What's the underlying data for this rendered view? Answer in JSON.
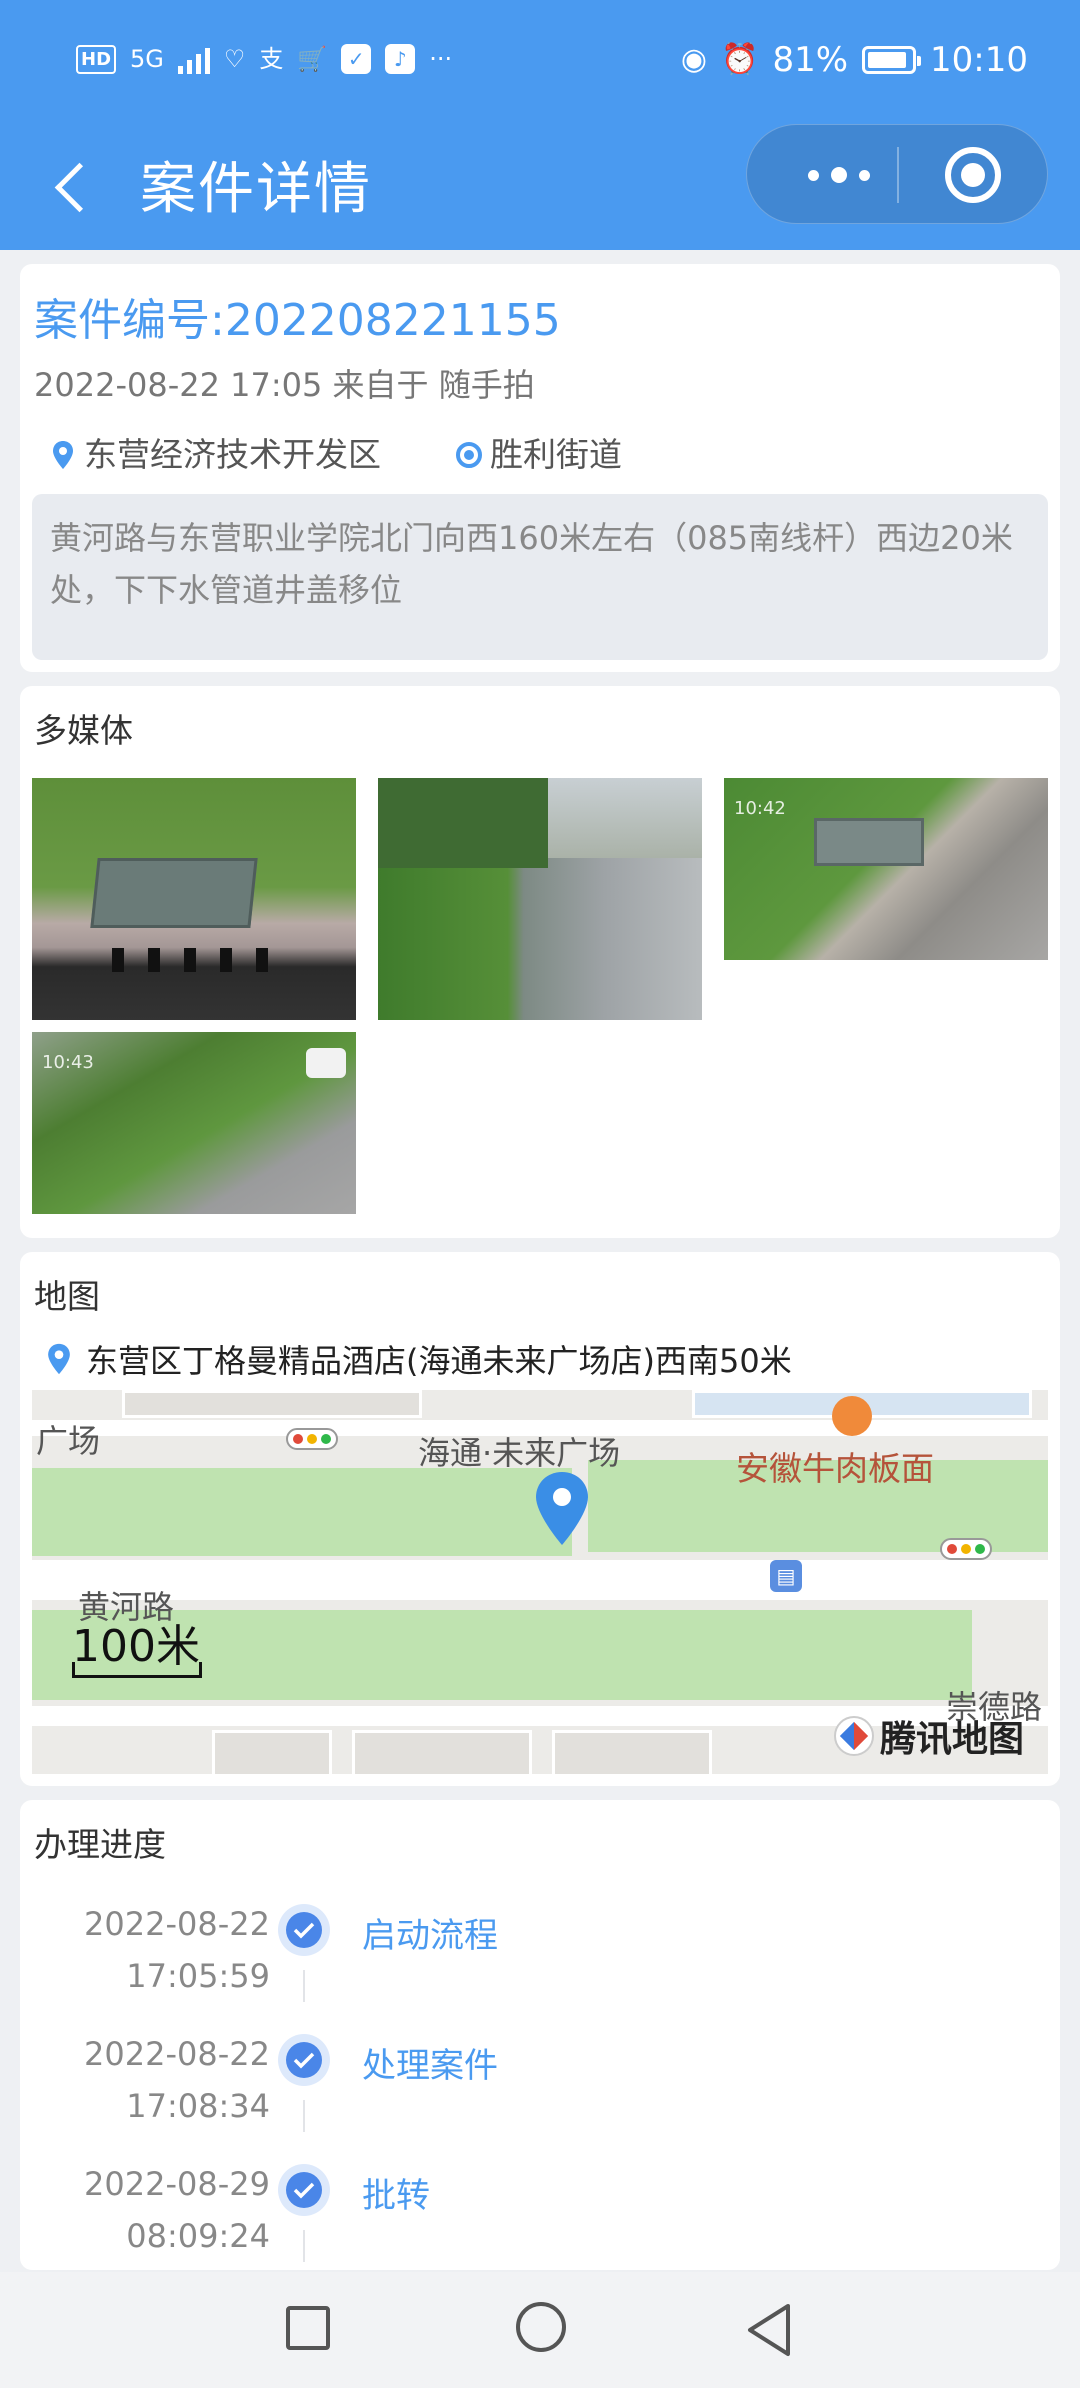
{
  "status_bar": {
    "network": "5G",
    "battery": "81%",
    "time": "10:10"
  },
  "header": {
    "title": "案件详情"
  },
  "case": {
    "number_label": "案件编号:202208221155",
    "meta": "2022-08-22 17:05 来自于 随手拍",
    "district": "东营经济技术开发区",
    "street": "胜利街道",
    "description": "黄河路与东营职业学院北门向西160米左右（085南线杆）西边20米处，下下水管道井盖移位"
  },
  "media": {
    "title": "多媒体",
    "photo3_time": "10:42",
    "photo4_time": "10:43"
  },
  "map": {
    "title": "地图",
    "address": "东营区丁格曼精品酒店(海通未来广场店)西南50米",
    "labels": {
      "plaza_left": "广场",
      "plaza": "海通·未来广场",
      "poi_food": "安徽牛肉板面",
      "road_huanghe": "黄河路",
      "road_chongde": "崇德路",
      "scale": "100米",
      "brand": "腾讯地图"
    }
  },
  "progress": {
    "title": "办理进度",
    "steps": [
      {
        "date": "2022-08-22",
        "time": "17:05:59",
        "name": "启动流程"
      },
      {
        "date": "2022-08-22",
        "time": "17:08:34",
        "name": "处理案件"
      },
      {
        "date": "2022-08-29",
        "time": "08:09:24",
        "name": "批转"
      }
    ]
  },
  "colors": {
    "primary": "#4a9af0",
    "accent_blue": "#4a86e8",
    "poi_brown": "#b5533a"
  }
}
